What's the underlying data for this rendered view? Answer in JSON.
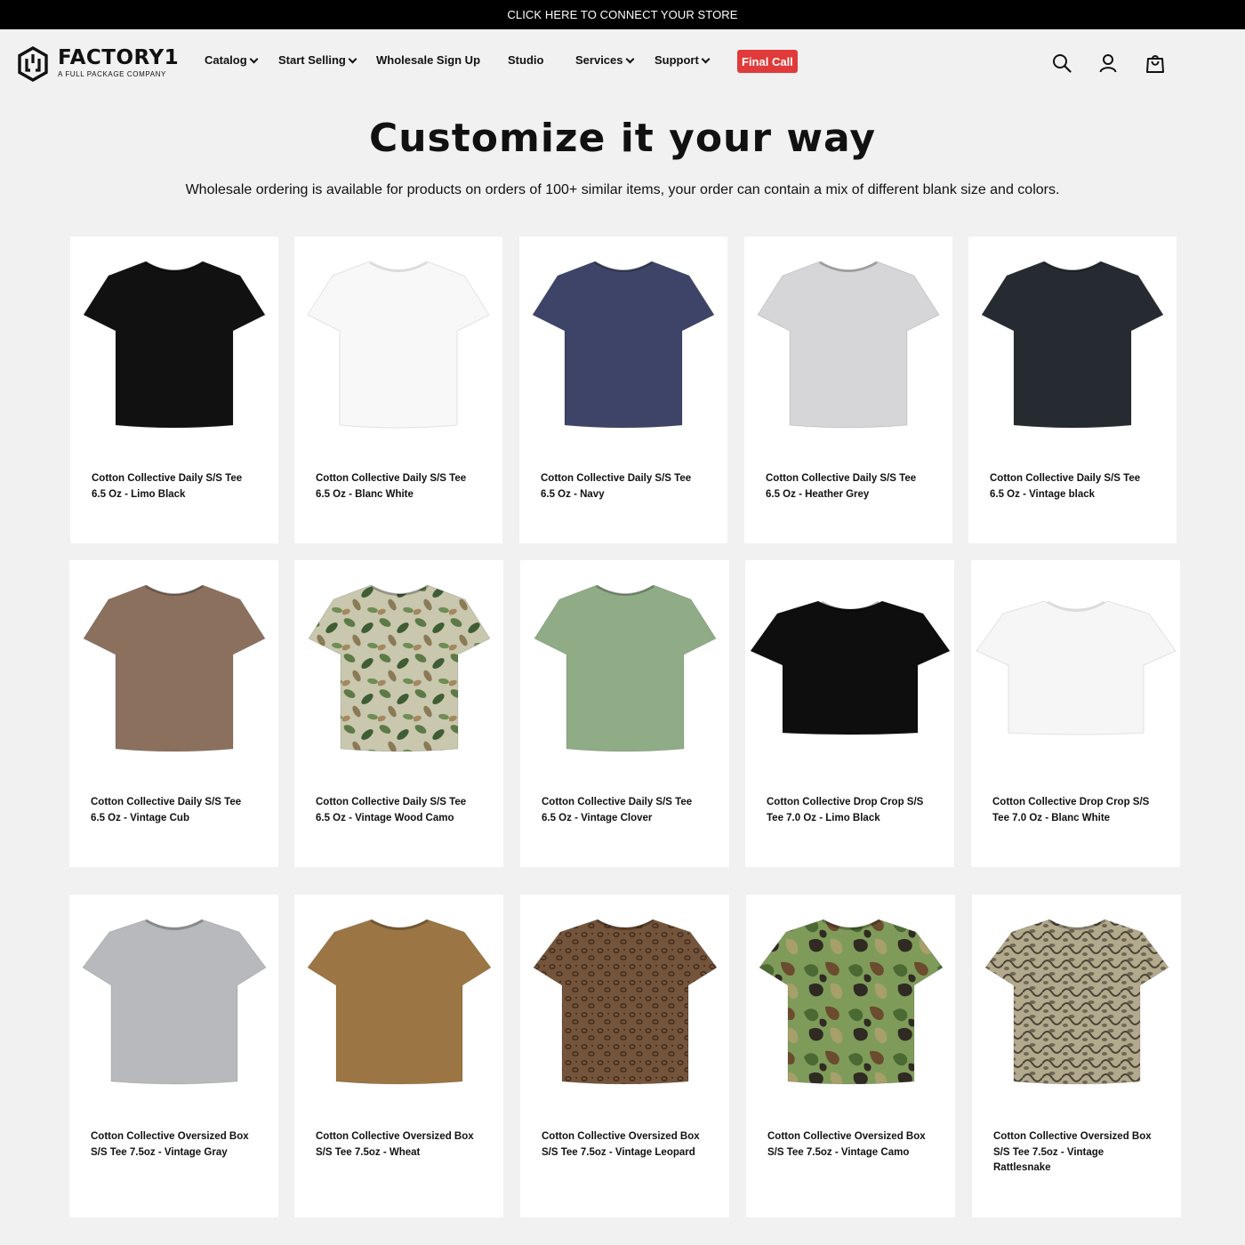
{
  "announcement": "CLICK HERE TO CONNECT YOUR STORE",
  "logo": {
    "name": "FACTORY1",
    "tagline": "A FULL PACKAGE COMPANY"
  },
  "nav": {
    "catalog": "Catalog",
    "start_selling": "Start Selling",
    "wholesale": "Wholesale Sign Up",
    "studio": "Studio",
    "services": "Services",
    "support": "Support",
    "final_call": "Final Call"
  },
  "icons": [
    "search-icon",
    "account-icon",
    "cart-icon"
  ],
  "heading": "Customize it your way",
  "subheading": "Wholesale ordering is available for products on orders of 100+ similar items, your order can contain a mix of different blank size and colors.",
  "products": [
    {
      "name": "Cotton Collective Daily S/S Tee 6.5 Oz - Limo Black",
      "color": "#111111"
    },
    {
      "name": "Cotton Collective Daily S/S Tee 6.5 Oz - Blanc White",
      "color": "#f8f8f8"
    },
    {
      "name": "Cotton Collective Daily S/S Tee 6.5 Oz - Navy",
      "color": "#3d4468"
    },
    {
      "name": "Cotton Collective Daily S/S Tee 6.5 Oz - Heather Grey",
      "color": "#d6d6d8"
    },
    {
      "name": "Cotton Collective Daily S/S Tee 6.5 Oz - Vintage black",
      "color": "#252b31"
    },
    {
      "name": "Cotton Collective Daily S/S Tee 6.5 Oz - Vintage Cub",
      "color": "#8c705e"
    },
    {
      "name": "Cotton Collective Daily S/S Tee 6.5 Oz - Vintage Wood Camo",
      "color": "#b5b89a",
      "pattern": "woodcamo"
    },
    {
      "name": "Cotton Collective Daily S/S Tee 6.5 Oz - Vintage Clover",
      "color": "#8fac86"
    },
    {
      "name": "Cotton Collective Drop Crop S/S Tee 7.0 Oz - Limo Black",
      "color": "#0e0e0e"
    },
    {
      "name": "Cotton Collective Drop Crop S/S Tee 7.0 Oz - Blanc White",
      "color": "#f6f6f6"
    },
    {
      "name": "Cotton Collective Oversized Box S/S Tee 7.5oz - Vintage Gray",
      "color": "#b7b9bc"
    },
    {
      "name": "Cotton Collective Oversized Box S/S Tee 7.5oz - Wheat",
      "color": "#9b7543"
    },
    {
      "name": "Cotton Collective Oversized Box S/S Tee 7.5oz - Vintage Leopard",
      "color": "#6e5036",
      "pattern": "leopard"
    },
    {
      "name": "Cotton Collective Oversized Box S/S Tee 7.5oz - Vintage Camo",
      "color": "#6a8a4a",
      "pattern": "camo"
    },
    {
      "name": "Cotton Collective Oversized Box S/S Tee 7.5oz - Vintage Rattlesnake",
      "color": "#8e8470",
      "pattern": "snake"
    }
  ]
}
